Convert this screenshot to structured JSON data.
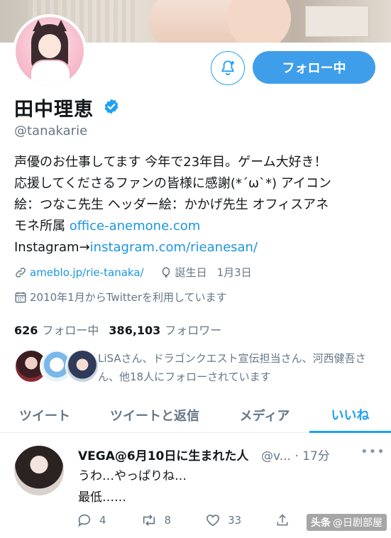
{
  "profile": {
    "display_name": "田中理恵",
    "handle": "@tanakarie",
    "follow_label": "フォロー中",
    "bio": {
      "line1": "声優のお仕事してます 今年で23年目。ゲーム大好き！",
      "line2": "応援してくださるファンの皆様に感謝(*´ω`*) アイコン",
      "line3": "絵：つなこ先生 ヘッダー絵：かかげ先生 オフィスアネ",
      "line4_text": "モネ所属 ",
      "line4_link": "office-anemone.com",
      "line5_text": "Instagram→",
      "line5_link": "instagram.com/rieanesan/"
    },
    "website": "ameblo.jp/rie-tanaka/",
    "birthday_label": "誕生日",
    "birthday_value": "1月3日",
    "joined": "2010年1月からTwitterを利用しています",
    "following_count": "626",
    "following_label": "フォロー中",
    "followers_count": "386,103",
    "followers_label": "フォロワー",
    "followers_you_know": "LiSAさん、ドラゴンクエスト宣伝担当さん、河西健吾さん、他18人にフォローされています"
  },
  "tabs": [
    {
      "label": "ツイート"
    },
    {
      "label": "ツイートと返信"
    },
    {
      "label": "メディア"
    },
    {
      "label": "いいね"
    }
  ],
  "tweet": {
    "author": "VEGA@6月10日に生まれた人",
    "handle_time": "@v... · 17分",
    "line1": "うわ…やっぱりね…",
    "line2": "最低……",
    "reply_count": "4",
    "retweet_count": "8",
    "like_count": "33"
  },
  "watermark": {
    "logo": "头条",
    "text": "@日剧部屋"
  },
  "colors": {
    "accent": "#1da1f2",
    "button": "#3e9eea",
    "link": "#1b95e0",
    "secondary_text": "#657786"
  }
}
